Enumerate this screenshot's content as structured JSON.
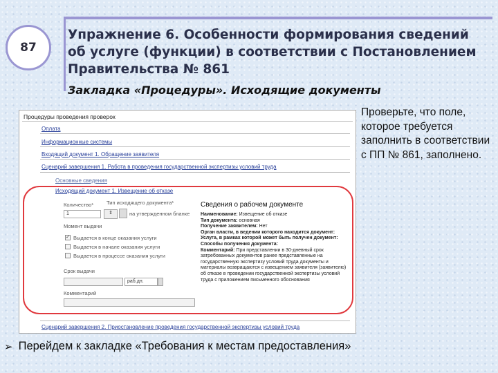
{
  "slide": {
    "number": "87",
    "title": "Упражнение 6. Особенности формирования сведений об услуге (функции) в соответствии с Постановлением Правительства № 861",
    "subtitle": "Закладка «Процедуры». Исходящие документы",
    "side_text": "Проверьте, что поле, которое требуется заполнить в соответствии с ПП № 861, заполнено.",
    "bullet_text": "Перейдем к закладке «Требования к местам предоставления»"
  },
  "screenshot": {
    "header": "Процедуры проведения проверок",
    "nav_links": [
      "Оплата",
      "Информационные системы",
      "Входящий документ 1. Обращение заявителя",
      "Сценарий завершения 1. Работа в проведения государственной экспертизы условий труда"
    ],
    "section_label": "Основные сведения",
    "outgoing_link": "Исходящий документ 1. Извещение об отказе",
    "form": {
      "qty_label": "Количество*",
      "qty_value": "1",
      "type_label": "Тип исходящего документа*",
      "type_value": "на утвержденном бланке",
      "issue_label": "Момент выдачи",
      "checkboxes": [
        {
          "label": "Выдается в конце оказания услуги",
          "checked": true
        },
        {
          "label": "Выдается в начале оказания услуги",
          "checked": false
        },
        {
          "label": "Выдается в процессе оказания услуги",
          "checked": false
        }
      ],
      "term_label": "Срок выдачи",
      "term_unit": "раб.дн.",
      "comment_label": "Комментарий"
    },
    "info": {
      "title": "Сведения о рабочем документе",
      "lines": [
        {
          "key": "Наименование:",
          "value": "Извещение об отказе"
        },
        {
          "key": "Тип документа:",
          "value": "основная"
        },
        {
          "key": "Получение заявителем:",
          "value": "Нет"
        },
        {
          "key": "Орган власти, в ведении которого находится документ:",
          "value": ""
        },
        {
          "key": "Услуга, в рамках которой может быть получен документ:",
          "value": ""
        },
        {
          "key": "Способы получения документа:",
          "value": ""
        },
        {
          "key": "Комментарий:",
          "value": "При представлении в 30-дневный срок затребованных документов ранее представленные на государственную экспертизу условий труда документы и материалы возвращаются с извещением заявителя (заявителю) об отказе в проведении государственной экспертизы условий труда с приложением письменного обоснования"
        }
      ]
    },
    "footer_link": "Сценарий завершения 2. Приостановление проведения государственной экспертизы условий труда"
  }
}
